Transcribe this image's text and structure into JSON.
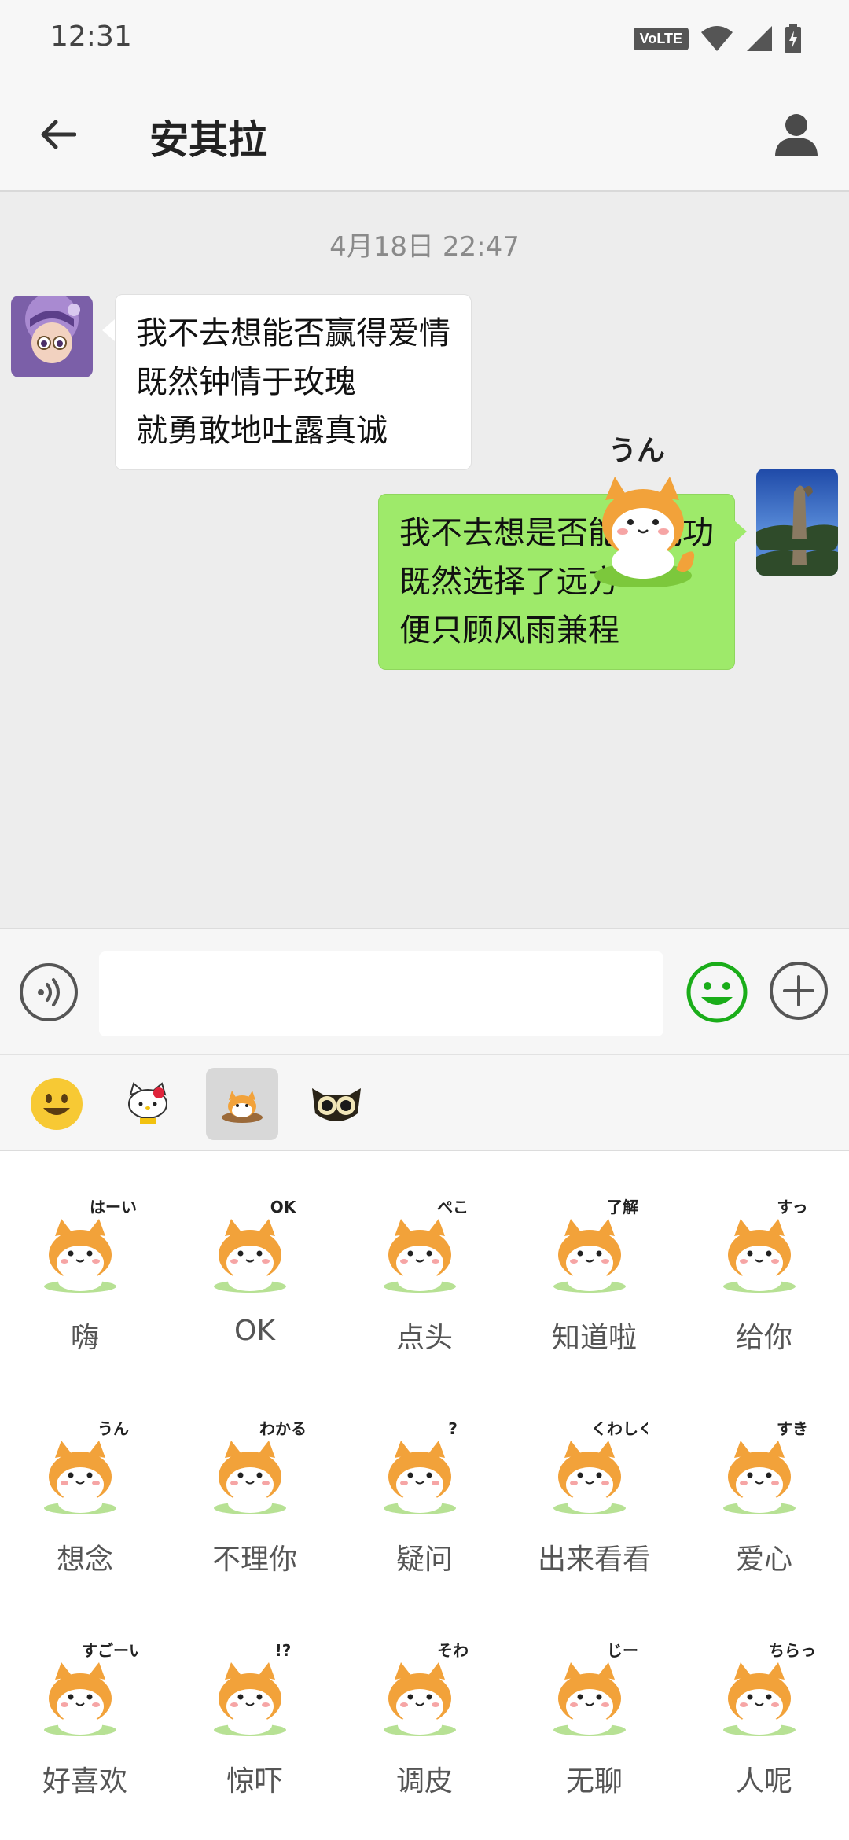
{
  "status_bar": {
    "time": "12:31",
    "volte": "VoLTE"
  },
  "header": {
    "title": "安其拉"
  },
  "chat": {
    "timestamp": "4月18日 22:47",
    "messages": [
      {
        "direction": "incoming",
        "lines": [
          "我不去想能否赢得爱情",
          "既然钟情于玫瑰",
          "就勇敢地吐露真诚"
        ]
      },
      {
        "direction": "outgoing",
        "lines": [
          "我不去想是否能够成功",
          "既然选择了远方",
          "便只顾风雨兼程"
        ]
      },
      {
        "direction": "outgoing",
        "type": "sticker",
        "sticker_text": "うん"
      }
    ]
  },
  "input": {
    "value": "",
    "placeholder": ""
  },
  "sticker_packs": [
    {
      "icon": "smiley-face-icon"
    },
    {
      "icon": "hello-kitty-icon"
    },
    {
      "icon": "shiba-pack-icon",
      "active": true
    },
    {
      "icon": "owl-icon"
    }
  ],
  "stickers": [
    {
      "label": "嗨",
      "art": "はーい"
    },
    {
      "label": "OK",
      "art": "OK"
    },
    {
      "label": "点头",
      "art": "ぺこ"
    },
    {
      "label": "知道啦",
      "art": "了解"
    },
    {
      "label": "给你",
      "art": "すっ"
    },
    {
      "label": "想念",
      "art": "うん"
    },
    {
      "label": "不理你",
      "art": "わかる"
    },
    {
      "label": "疑问",
      "art": "?"
    },
    {
      "label": "出来看看",
      "art": "くわしく"
    },
    {
      "label": "爱心",
      "art": "すき"
    },
    {
      "label": "好喜欢",
      "art": "すごーい"
    },
    {
      "label": "惊吓",
      "art": "!?"
    },
    {
      "label": "调皮",
      "art": "そわ"
    },
    {
      "label": "无聊",
      "art": "じー"
    },
    {
      "label": "人呢",
      "art": "ちらっ"
    }
  ],
  "colors": {
    "outgoing_bubble": "#9eea6a",
    "incoming_bubble": "#ffffff",
    "chat_background": "#ededed",
    "shiba_orange": "#f2a23a",
    "emoji_green": "#1aad19"
  }
}
